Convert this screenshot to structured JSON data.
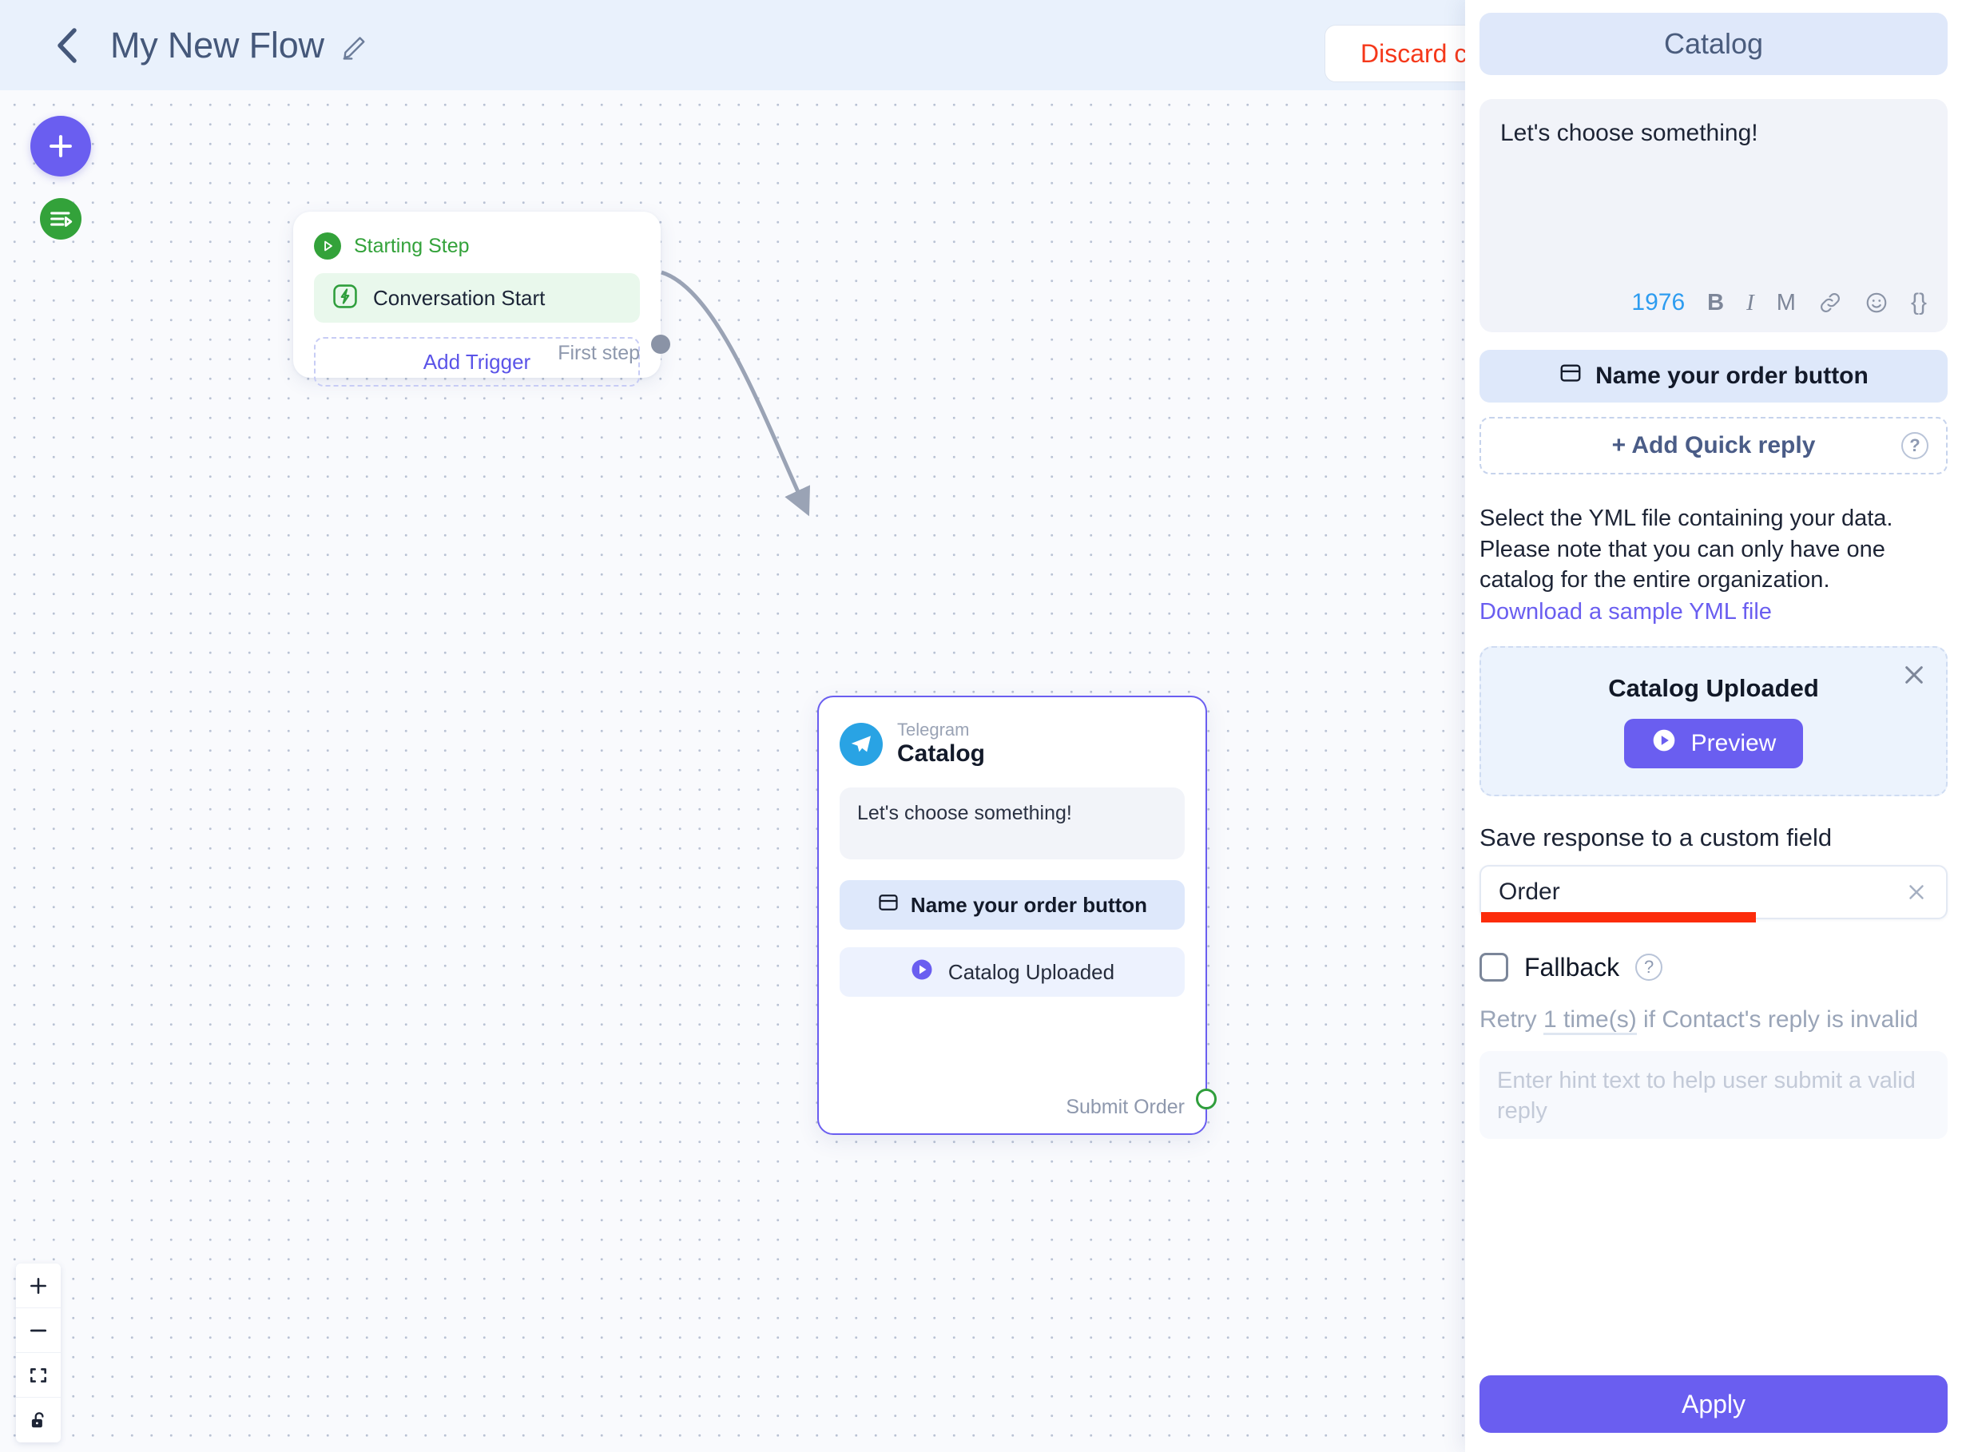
{
  "topbar": {
    "back_icon": "chevron-left-icon",
    "title": "My New Flow",
    "edit_icon": "pencil-icon",
    "discard_label": "Discard c"
  },
  "canvas": {
    "add_button_icon": "plus-icon",
    "start_button_icon": "flow-start-icon",
    "zoom_controls": [
      {
        "name": "zoom-in",
        "icon": "plus-icon"
      },
      {
        "name": "zoom-out",
        "icon": "minus-icon"
      },
      {
        "name": "fit-view",
        "icon": "fullscreen-icon"
      },
      {
        "name": "lock",
        "icon": "unlocked-padlock-icon"
      }
    ],
    "start_node": {
      "header_icon": "play-circle-icon",
      "header_label": "Starting Step",
      "trigger_icon": "lightning-bolt-icon",
      "trigger_label": "Conversation Start",
      "add_trigger_label": "Add Trigger",
      "footer_label": "First step"
    },
    "telegram_node": {
      "channel": "Telegram",
      "name": "Catalog",
      "message": "Let's choose something!",
      "order_button_icon": "card-layout-icon",
      "order_button_label": "Name your order button",
      "catalog_button_icon": "play-circle-icon",
      "catalog_button_label": "Catalog Uploaded",
      "footer_label": "Submit Order"
    }
  },
  "panel": {
    "header_title": "Catalog",
    "editor": {
      "text": "Let's choose something!",
      "char_count": "1976",
      "bold": "B",
      "italic": "I",
      "mono": "M",
      "link_icon": "link-icon",
      "emoji_icon": "smiley-icon",
      "variable_icon": "curly-braces-icon",
      "variable_glyph": "{}"
    },
    "order_button": {
      "icon": "card-layout-icon",
      "label": "Name your order button"
    },
    "quick_reply": {
      "label": "+ Add Quick reply",
      "help_icon": "question-mark-icon",
      "help_glyph": "?"
    },
    "yml": {
      "description": "Select the YML file containing your data. Please note that you can only have one catalog for the entire organization.",
      "link_label": "Download a sample YML file"
    },
    "upload_card": {
      "close_icon": "close-icon",
      "title": "Catalog Uploaded",
      "preview_icon": "play-circle-icon",
      "preview_label": "Preview"
    },
    "custom_field": {
      "label": "Save response to a custom field",
      "value": "Order",
      "clear_icon": "close-icon",
      "highlight_color": "#fc2c0b"
    },
    "fallback": {
      "label": "Fallback",
      "checked": false,
      "help_icon": "question-mark-icon",
      "help_glyph": "?",
      "retry_prefix": "Retry ",
      "retry_value": "1 time(s)",
      "retry_suffix": " if Contact's reply is invalid",
      "hint_placeholder": "Enter hint text to help user submit a valid reply"
    },
    "apply_label": "Apply"
  },
  "colors": {
    "accent": "#6a5ef0",
    "success": "#33a23a",
    "danger": "#f5381a",
    "telegram": "#29a3e4"
  }
}
